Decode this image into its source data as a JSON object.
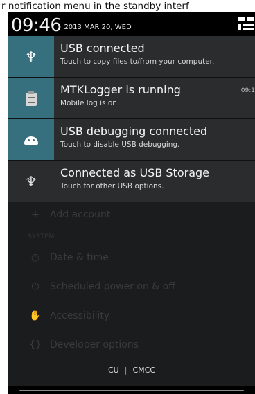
{
  "caption": "r notification menu in the standby interf",
  "status": {
    "clock": "09:46",
    "date": "2013 MAR 20, WED"
  },
  "notifications": [
    {
      "title": "USB connected",
      "subtitle": "Touch to copy files to/from your computer.",
      "icon": "usb-icon",
      "time": ""
    },
    {
      "title": "MTKLogger is running",
      "subtitle": "Mobile log is on.",
      "icon": "clipboard-icon",
      "time": "09:1"
    },
    {
      "title": "USB debugging connected",
      "subtitle": "Touch to disable USB debugging.",
      "icon": "android-icon",
      "time": ""
    },
    {
      "title": "Connected as USB Storage",
      "subtitle": "Touch for other USB options.",
      "icon": "usb-icon",
      "time": ""
    }
  ],
  "background": {
    "add_account": "Add account",
    "section": "SYSTEM",
    "items": [
      "Date & time",
      "Scheduled power on & off",
      "Accessibility",
      "Developer options"
    ]
  },
  "carrier": {
    "left": "CU",
    "sep": "|",
    "right": "CMCC"
  },
  "colors": {
    "accent_teal": "#36707f",
    "panel": "#2b2c2d",
    "header": "#000000"
  }
}
